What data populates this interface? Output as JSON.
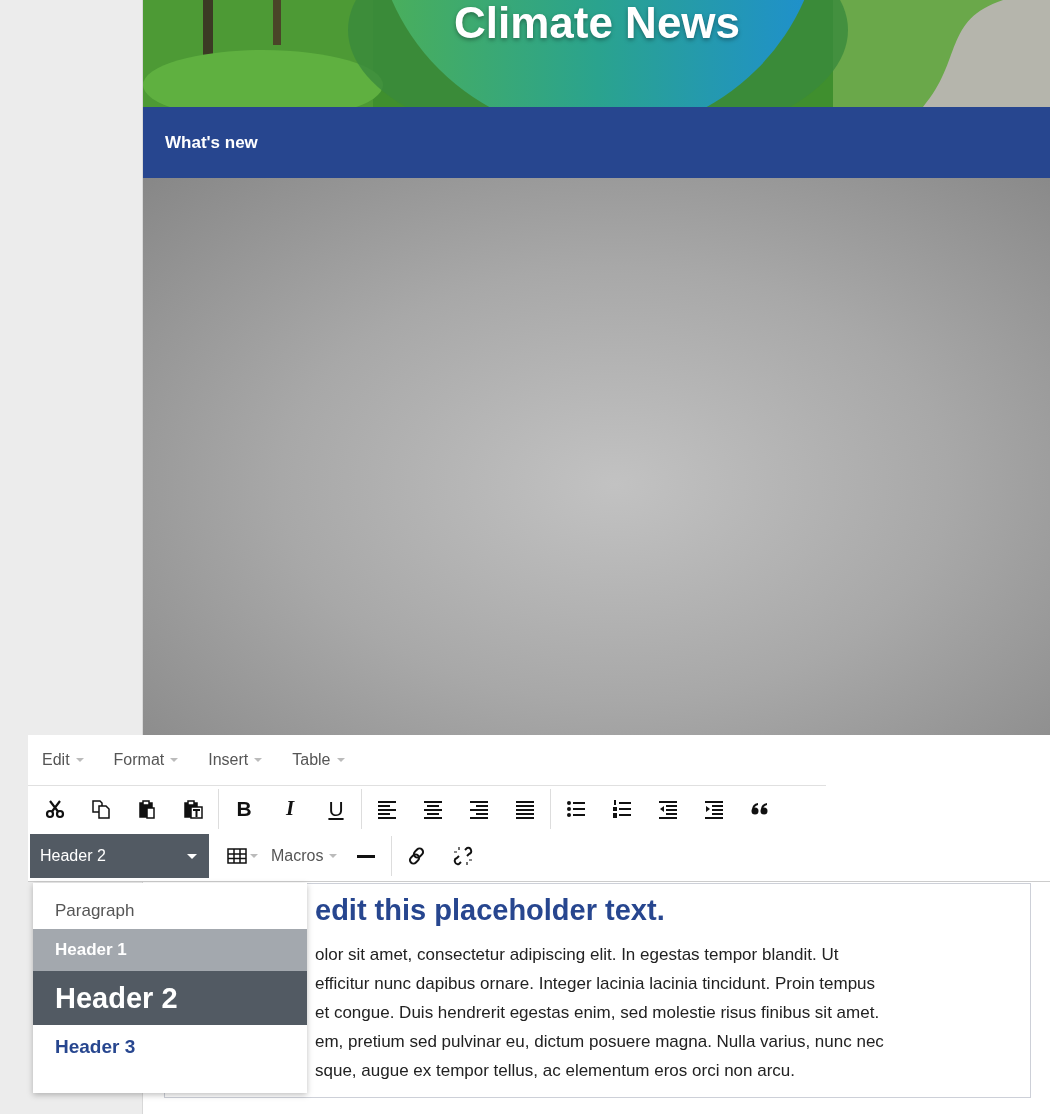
{
  "banner": {
    "title": "Climate News"
  },
  "nav": {
    "label": "What's new"
  },
  "editor": {
    "menus": [
      {
        "label": "Edit"
      },
      {
        "label": "Format"
      },
      {
        "label": "Insert"
      },
      {
        "label": "Table"
      }
    ],
    "text_style_buttons": [
      "B",
      "I",
      "U"
    ],
    "format_select": {
      "value": "Header 2"
    },
    "macros": {
      "label": "Macros"
    }
  },
  "format_menu": {
    "options": [
      {
        "kind": "paragraph",
        "label": "Paragraph",
        "selected": false,
        "hovered": false
      },
      {
        "kind": "h1",
        "label": "Header 1",
        "selected": false,
        "hovered": true
      },
      {
        "kind": "h2",
        "label": "Header 2",
        "selected": true,
        "hovered": false
      },
      {
        "kind": "h3",
        "label": "Header 3",
        "selected": false,
        "hovered": false
      }
    ]
  },
  "content": {
    "heading": "edit this placeholder text.",
    "lines": [
      "olor sit amet, consectetur adipiscing elit. In egestas tempor blandit. Ut",
      "efficitur nunc dapibus ornare. Integer lacinia lacinia tincidunt. Proin tempus",
      "et congue. Duis hendrerit egestas enim, sed molestie risus finibus sit amet.",
      "em, pretium sed pulvinar eu, dictum posuere magna. Nulla varius, nunc nec",
      "sque, augue ex tempor tellus, ac elementum eros orci non arcu."
    ]
  }
}
